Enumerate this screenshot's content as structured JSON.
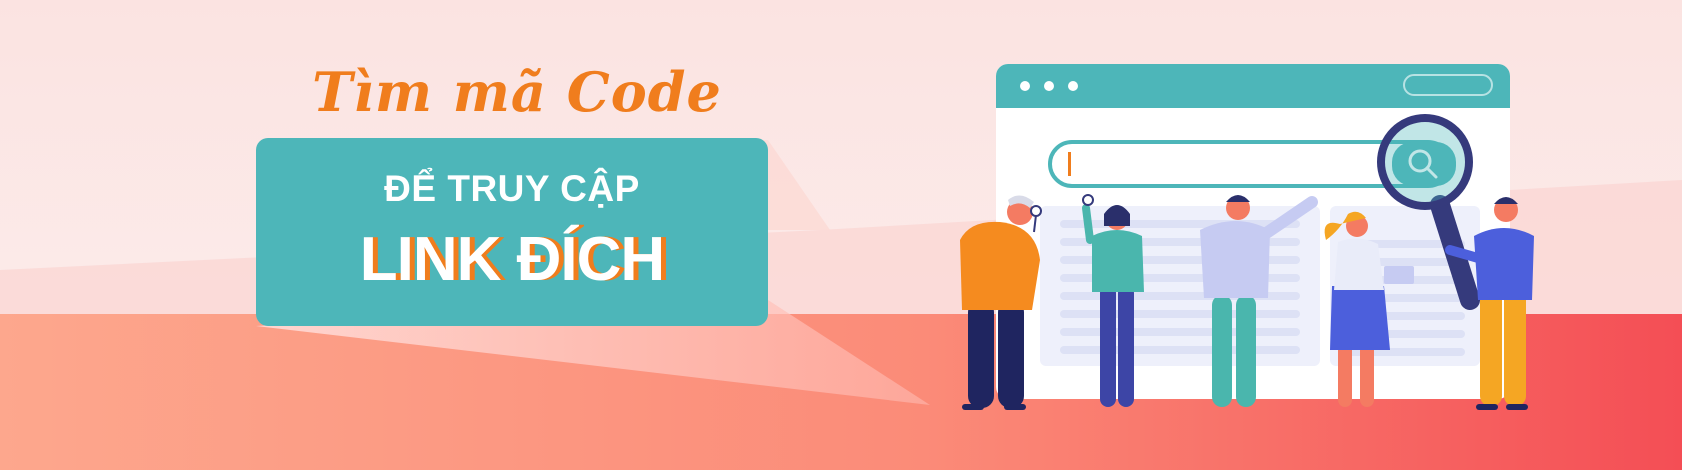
{
  "banner": {
    "tagline": "Tìm mã Code",
    "line1": "ĐỂ TRUY CẬP",
    "line2": "LINK ĐÍCH"
  },
  "colors": {
    "accent_orange": "#f07d1d",
    "teal": "#4db6b9",
    "background_light": "#fce8e6",
    "background_salmon": "#f86a5e",
    "navy": "#353a7c",
    "blue": "#4c5fdc"
  },
  "icons": [
    "window-dot-icon",
    "search-icon",
    "magnifying-glass-icon"
  ]
}
